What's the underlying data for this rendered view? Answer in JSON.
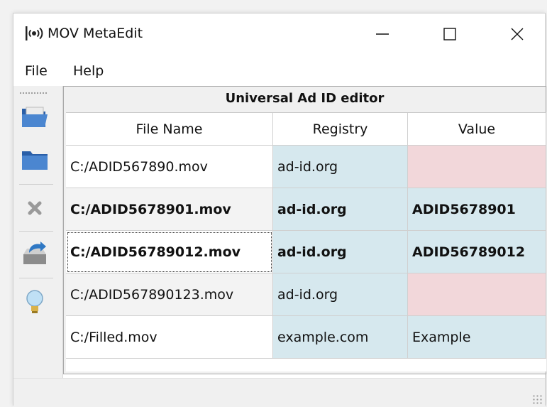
{
  "window": {
    "title": "MOV MetaEdit",
    "icon": "broadcast-icon",
    "controls": {
      "minimize": "minimize-icon",
      "maximize": "maximize-icon",
      "close": "close-icon"
    }
  },
  "menu": {
    "file": "File",
    "help": "Help"
  },
  "toolbar": {
    "items": [
      "open-file-icon",
      "open-folder-icon",
      "remove-icon",
      "save-icon",
      "hint-icon"
    ]
  },
  "editor": {
    "title": "Universal Ad ID editor",
    "columns": [
      "File Name",
      "Registry",
      "Value"
    ],
    "rows": [
      {
        "file": "C:/ADID567890.mov",
        "registry": "ad-id.org",
        "value": "",
        "bold": false,
        "row_bg": "#ffffff",
        "value_bg": "#f2d7da"
      },
      {
        "file": "C:/ADID5678901.mov",
        "registry": "ad-id.org",
        "value": "ADID5678901",
        "bold": true,
        "row_bg": "#f3f3f3",
        "value_bg": "#d6e8ee"
      },
      {
        "file": "C:/ADID56789012.mov",
        "registry": "ad-id.org",
        "value": "ADID56789012",
        "bold": true,
        "row_bg": "#ffffff",
        "value_bg": "#d6e8ee"
      },
      {
        "file": "C:/ADID567890123.mov",
        "registry": "ad-id.org",
        "value": "",
        "bold": false,
        "row_bg": "#f3f3f3",
        "value_bg": "#f2d7da"
      },
      {
        "file": "C:/Filled.mov",
        "registry": "example.com",
        "value": "Example",
        "bold": false,
        "row_bg": "#ffffff",
        "value_bg": "#d6e8ee"
      }
    ],
    "colors": {
      "registry_bg": "#d6e8ee",
      "invalid_value_bg": "#f2d7da"
    }
  }
}
